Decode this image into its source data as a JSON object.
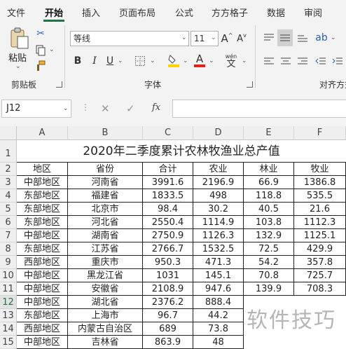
{
  "menu": {
    "items": [
      "文件",
      "开始",
      "插入",
      "页面布局",
      "公式",
      "方方格子",
      "数据",
      "审阅"
    ],
    "active_index": 1
  },
  "ribbon": {
    "paste_label": "粘贴",
    "clipboard_label": "剪贴板",
    "font_name": "等线",
    "font_size": "11",
    "font_label": "字体",
    "align_label": "对齐方式",
    "bold": "B",
    "italic": "I",
    "underline": "U",
    "grow_font": "A",
    "shrink_font": "A",
    "font_color_glyph": "A",
    "wen_glyph": "wén",
    "wen_char": "文",
    "accent_color": "#217346",
    "font_color": "#e0241b",
    "highlight_color": "#ffd200"
  },
  "formula_bar": {
    "name_box": "J12",
    "cancel": "✕",
    "enter": "✓",
    "fx": "fx",
    "value": ""
  },
  "sheet": {
    "columns": [
      "A",
      "B",
      "C",
      "D",
      "E",
      "F"
    ],
    "title": "2020年二季度累计农林牧渔业总产值",
    "headers": [
      "地区",
      "省份",
      "合计",
      "农业",
      "林业",
      "牧业"
    ],
    "rows": [
      {
        "n": "3",
        "cells": [
          "中部地区",
          "河南省",
          "3991.6",
          "2196.9",
          "66.9",
          "1386.8"
        ]
      },
      {
        "n": "4",
        "cells": [
          "东部地区",
          "福建省",
          "1833.5",
          "498",
          "118.8",
          "535.5"
        ]
      },
      {
        "n": "5",
        "cells": [
          "东部地区",
          "北京市",
          "98.4",
          "30.2",
          "40.5",
          "21.6"
        ]
      },
      {
        "n": "6",
        "cells": [
          "东部地区",
          "河北省",
          "2550.4",
          "1114.9",
          "103.8",
          "1112.3"
        ]
      },
      {
        "n": "7",
        "cells": [
          "中部地区",
          "湖南省",
          "2750.9",
          "1126.3",
          "132.9",
          "1125.1"
        ]
      },
      {
        "n": "8",
        "cells": [
          "东部地区",
          "江苏省",
          "2766.7",
          "1532.5",
          "72.5",
          "429.9"
        ]
      },
      {
        "n": "9",
        "cells": [
          "西部地区",
          "重庆市",
          "950.3",
          "471.3",
          "54.2",
          "357.8"
        ]
      },
      {
        "n": "10",
        "cells": [
          "中部地区",
          "黑龙江省",
          "1031",
          "145.1",
          "70.8",
          "725.7"
        ]
      },
      {
        "n": "11",
        "cells": [
          "中部地区",
          "安徽省",
          "2108.9",
          "947.6",
          "139.9",
          "708.3"
        ]
      },
      {
        "n": "12",
        "cells": [
          "中部地区",
          "湖北省",
          "2376.2",
          "888.4",
          "",
          ""
        ]
      },
      {
        "n": "13",
        "cells": [
          "东部地区",
          "上海市",
          "96.7",
          "44.2",
          "",
          ""
        ]
      },
      {
        "n": "14",
        "cells": [
          "西部地区",
          "内蒙古自治区",
          "689",
          "73.8",
          "",
          ""
        ]
      },
      {
        "n": "15",
        "cells": [
          "中部地区",
          "吉林省",
          "863.9",
          "48",
          "",
          ""
        ]
      }
    ],
    "selected_row": "12"
  },
  "watermark": "软件技巧"
}
